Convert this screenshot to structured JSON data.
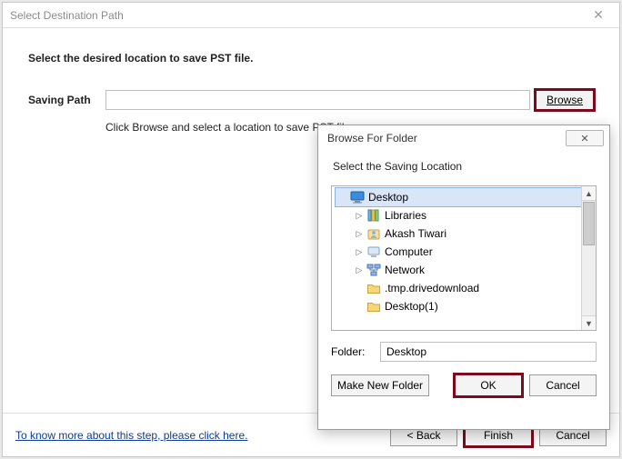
{
  "window": {
    "title": "Select Destination Path",
    "instruction": "Select the desired location to save PST file.",
    "saving_path_label": "Saving Path",
    "saving_path_value": "",
    "browse_label": "Browse",
    "helper_text": "Click Browse and select a location to save PST file",
    "help_link": "To know more about this step, please click here.",
    "back_label": "< Back",
    "finish_label": "Finish",
    "cancel_label": "Cancel"
  },
  "dialog": {
    "title": "Browse For Folder",
    "select_label": "Select the Saving Location",
    "tree": [
      {
        "label": "Desktop",
        "icon": "desktop-icon",
        "indent": false,
        "expander": "",
        "selected": true
      },
      {
        "label": "Libraries",
        "icon": "library-icon",
        "indent": true,
        "expander": "▷",
        "selected": false
      },
      {
        "label": "Akash Tiwari",
        "icon": "user-icon",
        "indent": true,
        "expander": "▷",
        "selected": false
      },
      {
        "label": "Computer",
        "icon": "computer-icon",
        "indent": true,
        "expander": "▷",
        "selected": false
      },
      {
        "label": "Network",
        "icon": "network-icon",
        "indent": true,
        "expander": "▷",
        "selected": false
      },
      {
        "label": ".tmp.drivedownload",
        "icon": "folder-icon",
        "indent": true,
        "expander": "",
        "selected": false
      },
      {
        "label": "Desktop(1)",
        "icon": "folder-icon",
        "indent": true,
        "expander": "",
        "selected": false
      }
    ],
    "folder_label": "Folder:",
    "folder_value": "Desktop",
    "make_new_label": "Make New Folder",
    "ok_label": "OK",
    "cancel_label": "Cancel"
  },
  "colors": {
    "highlight": "#7c0a1f"
  }
}
